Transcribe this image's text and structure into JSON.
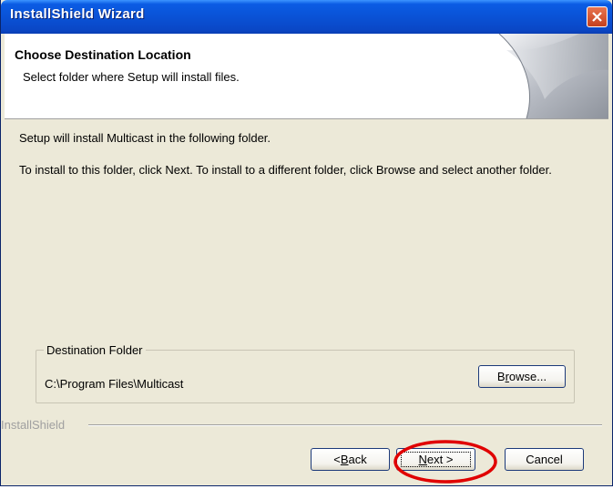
{
  "window": {
    "title": "InstallShield Wizard"
  },
  "header": {
    "title": "Choose Destination Location",
    "subtitle": "Select folder where Setup will install files."
  },
  "body": {
    "line1": "Setup will install Multicast in the following folder.",
    "line2": "To install to this folder, click Next. To install to a different folder, click Browse and select another folder."
  },
  "destination": {
    "label": "Destination Folder",
    "path": "C:\\Program Files\\Multicast",
    "browse_pre": "B",
    "browse_ul": "r",
    "browse_post": "owse..."
  },
  "footer": {
    "brand": "InstallShield",
    "back_pre": "< ",
    "back_ul": "B",
    "back_post": "ack",
    "next_ul": "N",
    "next_post": "ext >",
    "cancel": "Cancel"
  },
  "colors": {
    "titlebar": "#0a52d6",
    "window_bg": "#ece9d8",
    "highlight_ellipse": "#e00000"
  },
  "icons": {
    "close": "close-icon",
    "header_art": "page-curl-graphic"
  }
}
